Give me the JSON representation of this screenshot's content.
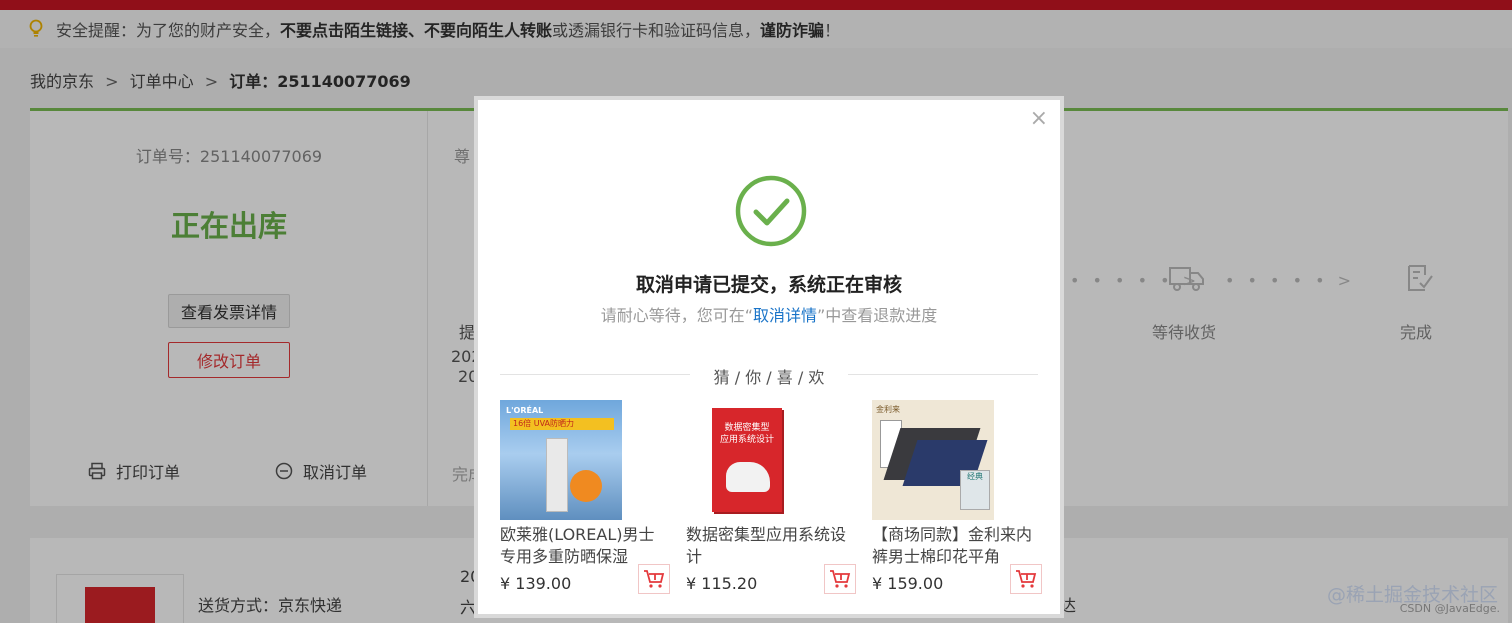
{
  "notice": {
    "prefix": "安全提醒：为了您的财产安全，",
    "bold1": "不要点击陌生链接、不要向陌生人转账",
    "middle": "或透漏银行卡和验证码信息，",
    "bold2": "谨防诈骗",
    "suffix": "！"
  },
  "breadcrumb": {
    "item1": "我的京东",
    "sep": ">",
    "item2": "订单中心",
    "current": "订单：251140077069"
  },
  "order": {
    "number": "订单号：251140077069",
    "status": "正在出库",
    "invoice_button": "查看发票详情",
    "modify_button": "修改订单",
    "print_label": "打印订单",
    "cancel_label": "取消订单",
    "mid_label": "尊",
    "mid_sub1": "提",
    "mid_sub2": "202",
    "mid_sub3": "20",
    "mid_done": "完成",
    "dots": "• • • • • >",
    "step_wait": "等待收货",
    "step_done": "完成"
  },
  "goods": {
    "ship": "送货方式：京东快递",
    "mid1": "20",
    "mid2": "六",
    "right": "达"
  },
  "modal": {
    "close": "×",
    "title": "取消申请已提交，系统正在审核",
    "sub_prefix": "请耐心等待，您可在“",
    "sub_link": "取消详情",
    "sub_suffix": "”中查看退款进度",
    "guess": "猜 / 你 / 喜 / 欢",
    "products": [
      {
        "name": "欧莱雅(LOREAL)男士专用多重防晒保湿",
        "price": "¥ 139.00",
        "img_text1": "16倍 UVA防晒力",
        "img_text2": "L'ORÉAL"
      },
      {
        "name": "数据密集型应用系统设计",
        "price": "¥ 115.20",
        "img_text1": "数据密集型",
        "img_text2": "应用系统设计"
      },
      {
        "name": "【商场同款】金利来内裤男士棉印花平角",
        "price": "¥ 159.00",
        "img_text1": "金利来",
        "img_text2": "经典"
      }
    ]
  },
  "watermark": {
    "main": "@稀土掘金技术社区",
    "sub": "CSDN @JavaEdge."
  }
}
